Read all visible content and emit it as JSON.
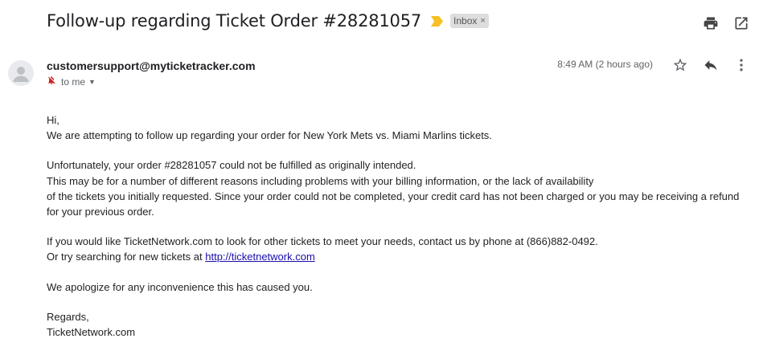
{
  "header": {
    "subject": "Follow-up regarding Ticket Order #28281057",
    "label": "Inbox",
    "label_close": "×"
  },
  "icons": {
    "importance": "importance-marker-icon",
    "print": "print-icon",
    "open_new_window": "open-in-new-window-icon",
    "star": "star-icon",
    "reply": "reply-icon",
    "more": "more-vert-icon",
    "avatar": "avatar-icon",
    "muted": "notifications-off-icon"
  },
  "colors": {
    "importance": "#f6c026",
    "link": "#1a0dab",
    "muted": "#c5221f"
  },
  "message": {
    "sender": "customersupport@myticketracker.com",
    "recipient": "to me",
    "chevron": "▼",
    "timestamp": "8:49 AM (2 hours ago)",
    "body": {
      "greeting": "Hi,",
      "line1": "We are attempting to follow up regarding your order for New York Mets vs. Miami Marlins tickets.",
      "line2": "Unfortunately, your order #28281057 could not be fulfilled as originally intended.",
      "line3": "This may be for a number of different reasons including problems with your billing information, or the lack of availability",
      "line4": "of the tickets you initially requested. Since your order could not be completed, your credit card has not been charged or you may be receiving a refund",
      "line5": "for your previous order.",
      "line6": "If you would like TicketNetwork.com to look for other tickets to meet your needs, contact us by phone at (866)882-0492.",
      "line7_prefix": "Or try searching for new tickets at ",
      "line7_link": "http://ticketnetwork.com",
      "line8": "We apologize for any inconvenience this has caused you.",
      "closing": "Regards,",
      "signature": "TicketNetwork.com"
    }
  }
}
